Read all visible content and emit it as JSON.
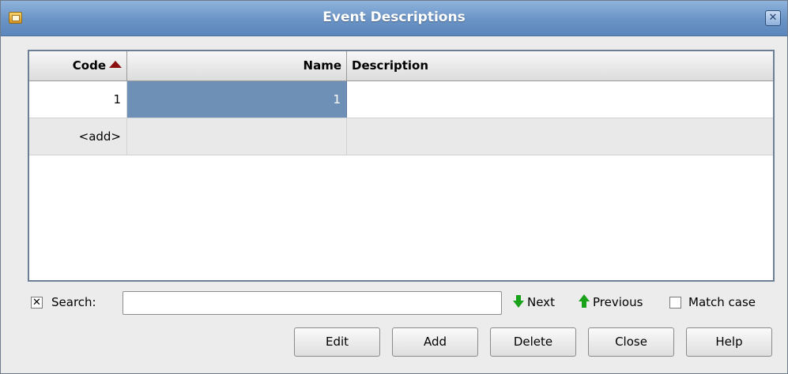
{
  "window": {
    "title": "Event Descriptions"
  },
  "table": {
    "columns": [
      {
        "label": "Code",
        "sorted": "ascending"
      },
      {
        "label": "Name"
      },
      {
        "label": "Description"
      }
    ],
    "rows": [
      {
        "code": "1",
        "name": "1",
        "description": ""
      },
      {
        "code": "<add>",
        "name": "",
        "description": ""
      }
    ]
  },
  "search": {
    "checkbox_checked_glyph": "✕",
    "label": "Search:",
    "value": "",
    "next_label": "Next",
    "previous_label": "Previous",
    "match_case_label": "Match case"
  },
  "buttons": {
    "edit": "Edit",
    "add": "Add",
    "delete": "Delete",
    "close": "Close",
    "help": "Help"
  },
  "colors": {
    "titlebar": "#6a93c5",
    "selection": "#6e8fb6",
    "sort_arrow": "#8b1010",
    "nav_arrows": "#1aa31a"
  }
}
